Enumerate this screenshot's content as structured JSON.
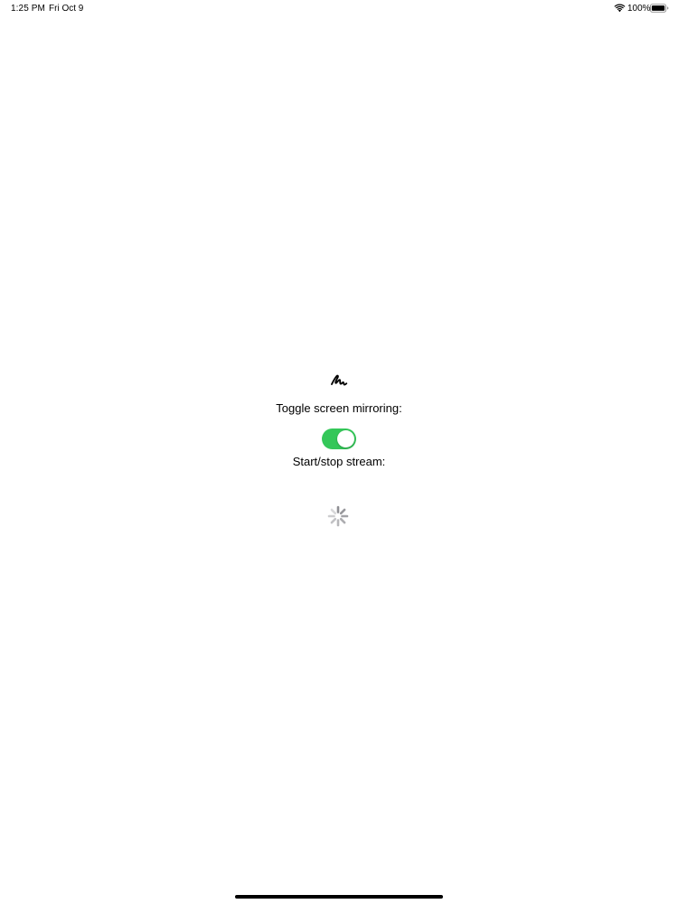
{
  "status_bar": {
    "time": "1:25 PM",
    "date": "Fri Oct 9",
    "battery_percent": "100%",
    "wifi_icon": "wifi-icon",
    "battery_icon": "battery-icon"
  },
  "main": {
    "header_icon": "signature-icon",
    "mirroring_label": "Toggle screen mirroring:",
    "mirroring_toggle_on": true,
    "stream_label": "Start/stop stream:",
    "loading_icon": "spinner-icon"
  },
  "colors": {
    "toggle_on": "#34C759",
    "spinner": "#8E8E93"
  }
}
